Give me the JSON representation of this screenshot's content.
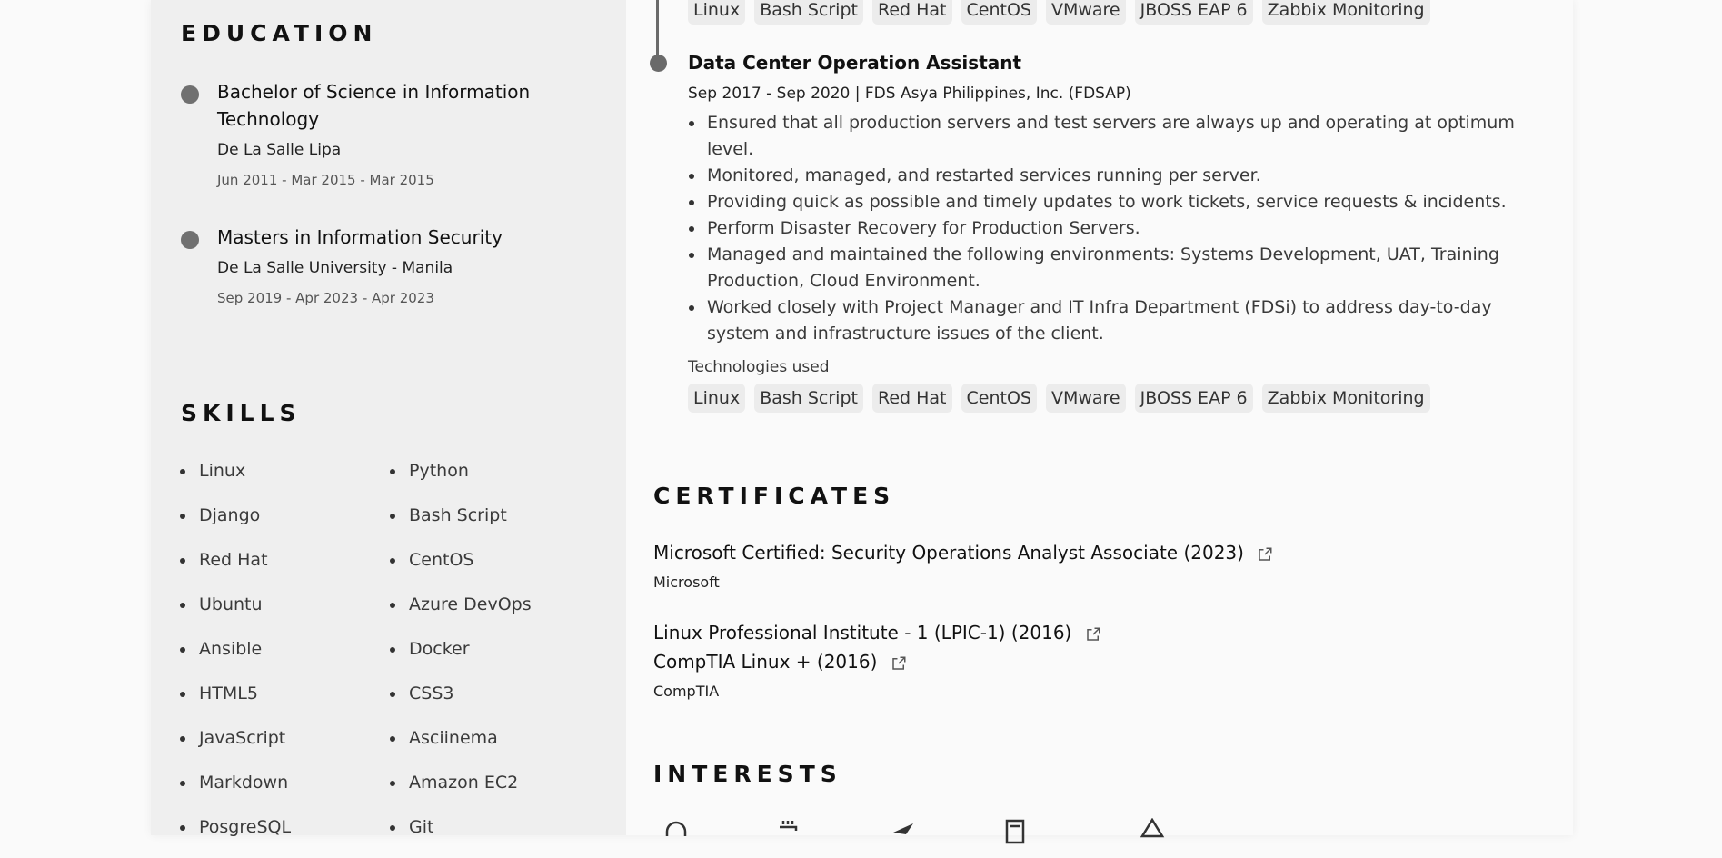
{
  "education": {
    "title": "EDUCATION",
    "items": [
      {
        "degree": "Bachelor of Science in Information Technology",
        "school": "De La Salle Lipa",
        "dates": "Jun 2011 - Mar 2015 - Mar 2015"
      },
      {
        "degree": "Masters in Information Security",
        "school": "De La Salle University - Manila",
        "dates": "Sep 2019 - Apr 2023 - Apr 2023"
      }
    ]
  },
  "skills": {
    "title": "SKILLS",
    "col1": [
      "Linux",
      "Django",
      "Red Hat",
      "Ubuntu",
      "Ansible",
      "HTML5",
      "JavaScript",
      "Markdown",
      "PosgreSQL"
    ],
    "col2": [
      "Python",
      "Bash Script",
      "CentOS",
      "Azure DevOps",
      "Docker",
      "CSS3",
      "Asciinema",
      "Amazon EC2",
      "Git"
    ]
  },
  "experience": {
    "prev_tags": [
      "Linux",
      "Bash Script",
      "Red Hat",
      "CentOS",
      "VMware",
      "JBOSS EAP 6",
      "Zabbix Monitoring"
    ],
    "job": {
      "title": "Data Center Operation Assistant",
      "meta": "Sep 2017 - Sep 2020 | FDS Asya Philippines, Inc. (FDSAP)",
      "bullets": [
        "Ensured that all production servers and test servers are always up and operating at optimum level.",
        "Monitored, managed, and restarted services running per server.",
        "Providing quick as possible and timely updates to work tickets, service requests & incidents.",
        "Perform Disaster Recovery for Production Servers.",
        "Managed and maintained the following environments: Systems Development, UAT, Training Production, Cloud Environment.",
        "Worked closely with Project Manager and IT Infra Department (FDSi) to address day-to-day system and infrastructure issues of the client."
      ],
      "tech_label": "Technologies used",
      "tags": [
        "Linux",
        "Bash Script",
        "Red Hat",
        "CentOS",
        "VMware",
        "JBOSS EAP 6",
        "Zabbix Monitoring"
      ]
    }
  },
  "certificates": {
    "title": "CERTIFICATES",
    "items": [
      {
        "name": "Microsoft Certified: Security Operations Analyst Associate (2023)",
        "issuer": "Microsoft",
        "icon": "external-link-icon"
      },
      {
        "name": "Linux Professional Institute - 1 (LPIC-1) (2016)",
        "icon": "external-link-icon"
      },
      {
        "name": "CompTIA Linux + (2016)",
        "issuer": "CompTIA",
        "icon": "external-link-icon"
      }
    ]
  },
  "interests": {
    "title": "INTERESTS",
    "icons": [
      "headphones-icon",
      "coffee-icon",
      "airplane-icon",
      "book-icon",
      "sailboat-icon"
    ]
  }
}
